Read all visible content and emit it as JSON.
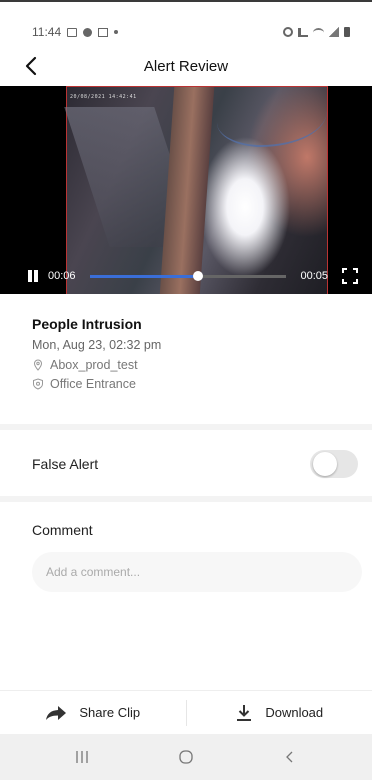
{
  "status_bar": {
    "time": "11:44",
    "left_icons": [
      "gallery-icon",
      "facebook-icon",
      "mail-icon",
      "dot-icon"
    ],
    "right_icons": [
      "alarm-icon",
      "mute-icon",
      "wifi-icon",
      "signal-icon",
      "battery-icon"
    ]
  },
  "header": {
    "title": "Alert Review",
    "back_icon": "chevron-left-icon"
  },
  "video": {
    "overlay_timestamp": "20/08/2021 14:42:41",
    "current_time": "00:06",
    "remaining_time": "00:05",
    "progress_fraction": 0.55,
    "bar_colors": {
      "fill": "#3a6ed8",
      "track": "#666666"
    }
  },
  "event": {
    "title": "People Intrusion",
    "datetime": "Mon, Aug 23, 02:32 pm",
    "location": "Abox_prod_test",
    "camera": "Office Entrance",
    "location_icon": "map-pin-icon",
    "camera_icon": "shield-icon"
  },
  "false_alert": {
    "label": "False Alert",
    "enabled": false
  },
  "comment": {
    "label": "Comment",
    "placeholder": "Add a comment...",
    "value": ""
  },
  "actions": {
    "share_label": "Share Clip",
    "download_label": "Download"
  },
  "nav": {
    "recents_icon": "recents-icon",
    "home_icon": "home-icon",
    "back_icon": "back-icon"
  }
}
